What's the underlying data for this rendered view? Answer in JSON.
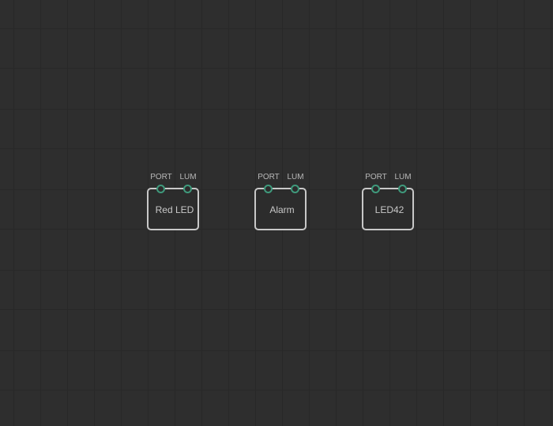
{
  "canvas": {
    "background_color": "#2e2e2e",
    "grid_color": "#282828",
    "pin_color": "#3f9a7c",
    "node_border_color": "#c8c8c8"
  },
  "nodes": [
    {
      "label": "Red LED",
      "pins": [
        {
          "label": "PORT"
        },
        {
          "label": "LUM"
        }
      ]
    },
    {
      "label": "Alarm",
      "pins": [
        {
          "label": "PORT"
        },
        {
          "label": "LUM"
        }
      ]
    },
    {
      "label": "LED42",
      "pins": [
        {
          "label": "PORT"
        },
        {
          "label": "LUM"
        }
      ]
    }
  ]
}
